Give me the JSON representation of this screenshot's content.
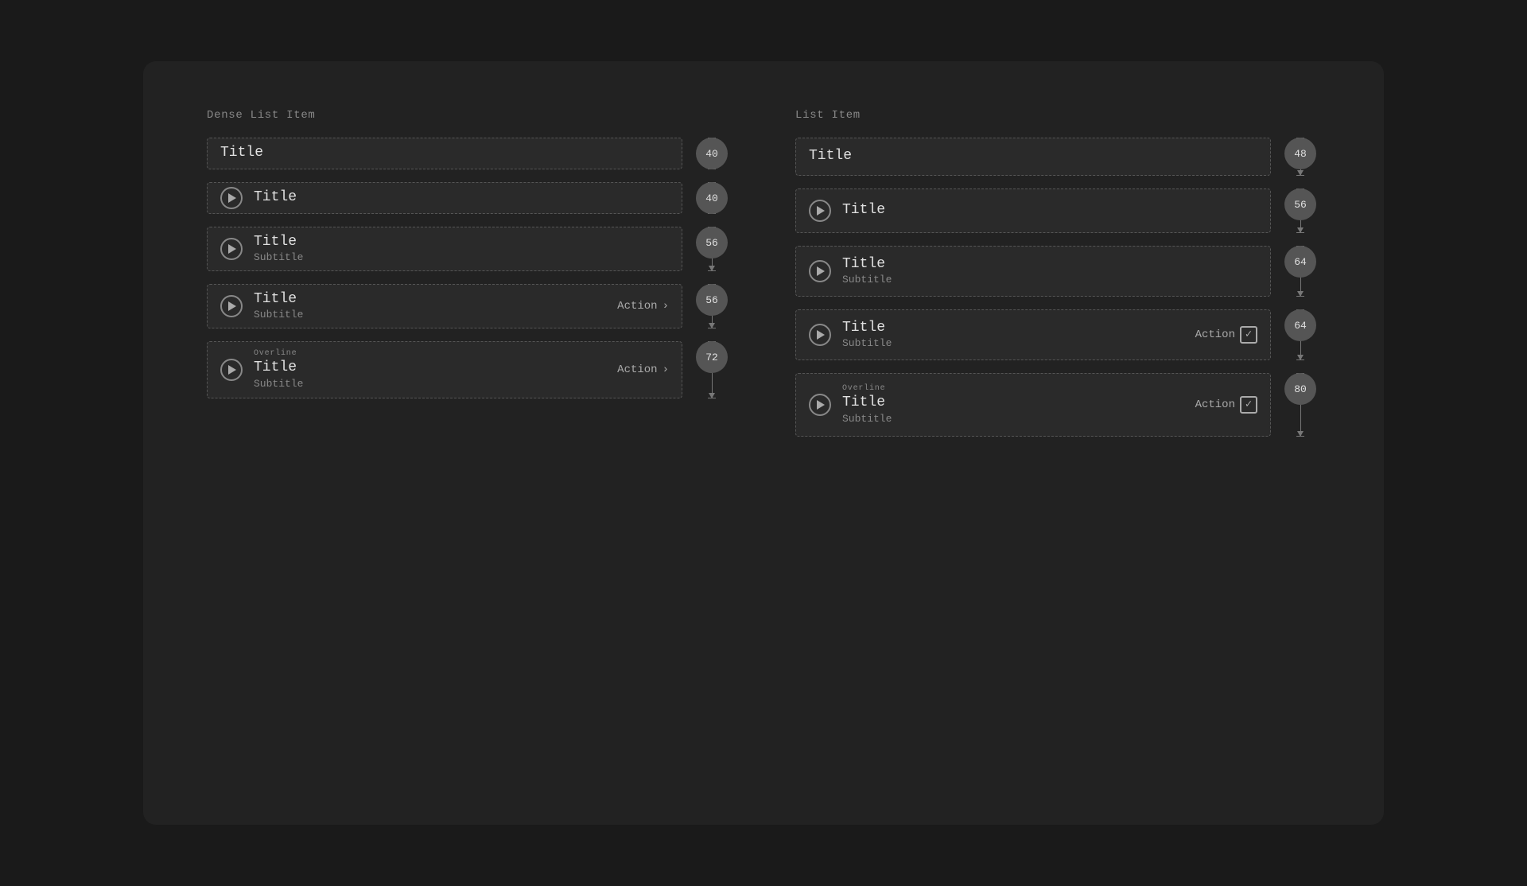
{
  "columns": [
    {
      "id": "dense",
      "label": "Dense List Item",
      "items": [
        {
          "id": "dense-1",
          "hasIcon": false,
          "hasOverline": false,
          "title": "Title",
          "subtitle": null,
          "hasAction": false,
          "actionLabel": null,
          "size": 40,
          "heightClass": "h40",
          "actionType": null
        },
        {
          "id": "dense-2",
          "hasIcon": true,
          "hasOverline": false,
          "title": "Title",
          "subtitle": null,
          "hasAction": false,
          "actionLabel": null,
          "size": 40,
          "heightClass": "h40",
          "actionType": null
        },
        {
          "id": "dense-3",
          "hasIcon": true,
          "hasOverline": false,
          "title": "Title",
          "subtitle": "Subtitle",
          "hasAction": false,
          "actionLabel": null,
          "size": 56,
          "heightClass": "h56",
          "actionType": null
        },
        {
          "id": "dense-4",
          "hasIcon": true,
          "hasOverline": false,
          "title": "Title",
          "subtitle": "Subtitle",
          "hasAction": true,
          "actionLabel": "Action",
          "size": 56,
          "heightClass": "h56",
          "actionType": "chevron"
        },
        {
          "id": "dense-5",
          "hasIcon": true,
          "hasOverline": true,
          "overline": "Overline",
          "title": "Title",
          "subtitle": "Subtitle",
          "hasAction": true,
          "actionLabel": "Action",
          "size": 72,
          "heightClass": "h72",
          "actionType": "chevron"
        }
      ]
    },
    {
      "id": "list",
      "label": "List Item",
      "items": [
        {
          "id": "list-1",
          "hasIcon": false,
          "hasOverline": false,
          "title": "Title",
          "subtitle": null,
          "hasAction": false,
          "actionLabel": null,
          "size": 48,
          "heightClass": "h48",
          "actionType": null
        },
        {
          "id": "list-2",
          "hasIcon": true,
          "hasOverline": false,
          "title": "Title",
          "subtitle": null,
          "hasAction": false,
          "actionLabel": null,
          "size": 56,
          "heightClass": "h56",
          "actionType": null
        },
        {
          "id": "list-3",
          "hasIcon": true,
          "hasOverline": false,
          "title": "Title",
          "subtitle": "Subtitle",
          "hasAction": false,
          "actionLabel": null,
          "size": 64,
          "heightClass": "h64",
          "actionType": null
        },
        {
          "id": "list-4",
          "hasIcon": true,
          "hasOverline": false,
          "title": "Title",
          "subtitle": "Subtitle",
          "hasAction": true,
          "actionLabel": "Action",
          "size": 64,
          "heightClass": "h64",
          "actionType": "checkbox"
        },
        {
          "id": "list-5",
          "hasIcon": true,
          "hasOverline": true,
          "overline": "Overline",
          "title": "Title",
          "subtitle": "Subtitle",
          "hasAction": true,
          "actionLabel": "Action",
          "size": 80,
          "heightClass": "h80",
          "actionType": "checkbox"
        }
      ]
    }
  ]
}
